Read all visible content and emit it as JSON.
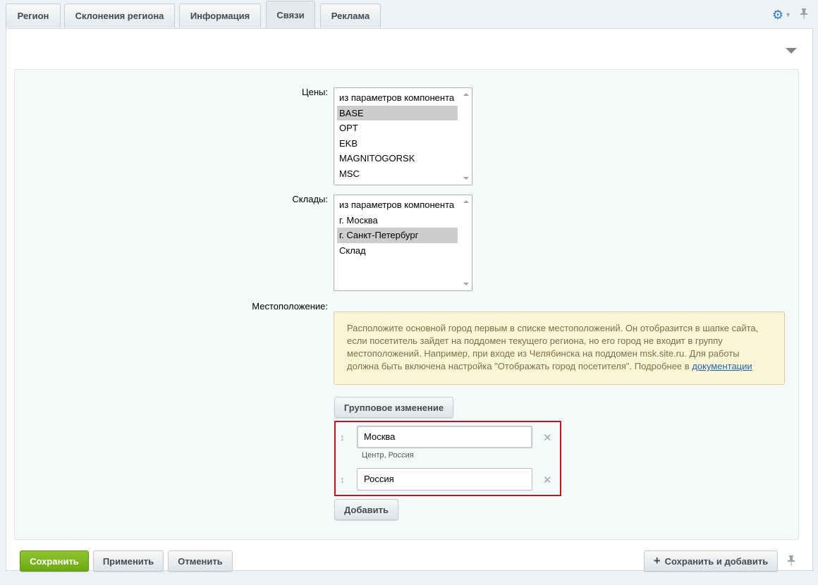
{
  "tabs": [
    {
      "label": "Регион",
      "active": false
    },
    {
      "label": "Склонения региона",
      "active": false
    },
    {
      "label": "Информация",
      "active": false
    },
    {
      "label": "Связи",
      "active": true
    },
    {
      "label": "Реклама",
      "active": false
    }
  ],
  "prices": {
    "label": "Цены:",
    "options": [
      "из параметров компонента",
      "BASE",
      "OPT",
      "EKB",
      "MAGNITOGORSK",
      "MSC"
    ],
    "selected": "BASE"
  },
  "warehouses": {
    "label": "Склады:",
    "options": [
      "из параметров компонента",
      "г. Москва",
      "г. Санкт-Петербург",
      "Склад"
    ],
    "selected": "г. Санкт-Петербург"
  },
  "location": {
    "label": "Местоположение:",
    "notice_text": "Расположите основной город первым в списке местоположений. Он отобразится в шапке сайта, если посетитель зайдет на поддомен текущего региона, но его город не входит в группу местоположений. Например, при входе из Челябинска на поддомен msk.site.ru. Для работы должна быть включена настройка \"Отображать город посетителя\". Подробнее в ",
    "notice_link": "документации",
    "group_button": "Групповое изменение",
    "items": [
      {
        "value": "Москва",
        "sub": "Центр, Россия"
      },
      {
        "value": "Россия",
        "sub": ""
      }
    ],
    "add_button": "Добавить"
  },
  "footer": {
    "save": "Сохранить",
    "apply": "Применить",
    "cancel": "Отменить",
    "save_add": "Сохранить и добавить"
  },
  "colors": {
    "accent_green": "#7ab51d",
    "highlight_red": "#c8101e",
    "gear_blue": "#2b7bcc"
  }
}
